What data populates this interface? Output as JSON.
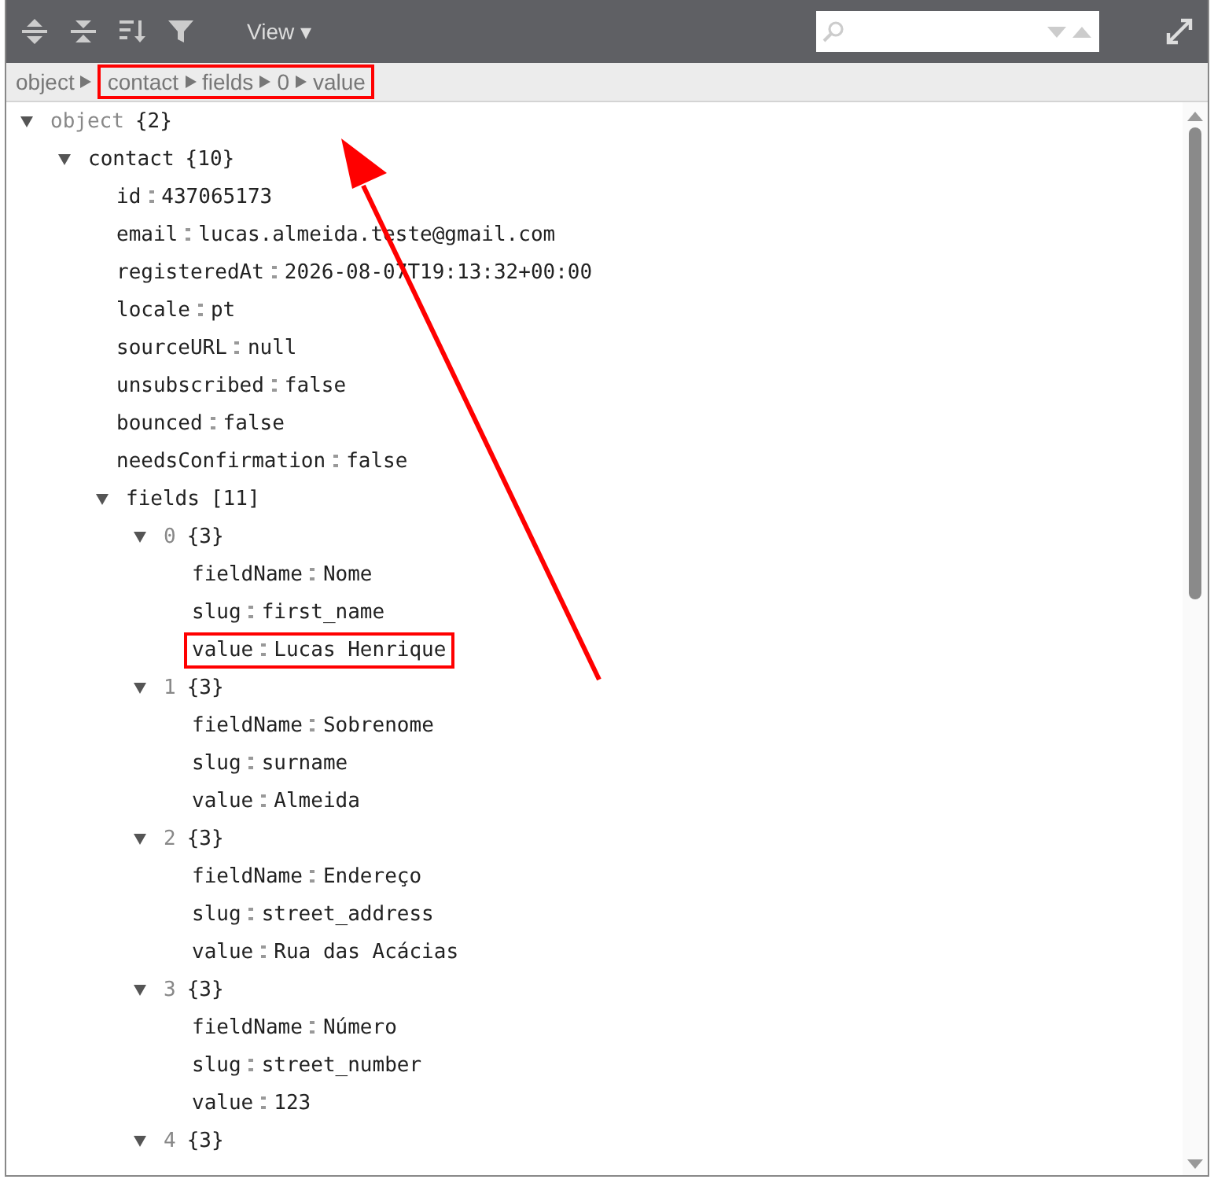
{
  "toolbar": {
    "view_menu": "View ▾"
  },
  "breadcrumb": [
    {
      "label": "object",
      "highlighted": false
    },
    {
      "label": "contact",
      "highlighted": true
    },
    {
      "label": "fields",
      "highlighted": true
    },
    {
      "label": "0",
      "highlighted": true
    },
    {
      "label": "value",
      "highlighted": true
    }
  ],
  "tree": [
    {
      "key": "object",
      "kind": "root",
      "summary": "{2}",
      "expanded": true,
      "children": [
        {
          "key": "contact",
          "kind": "property",
          "summary": "{10}",
          "expanded": true,
          "children": [
            {
              "key": "id ",
              "value": "437065173"
            },
            {
              "key": "email",
              "value": "lucas.almeida.teste@gmail.com"
            },
            {
              "key": "registeredAt",
              "value": "2026-08-07T19:13:32+00:00"
            },
            {
              "key": "locale",
              "value": "pt"
            },
            {
              "key": "sourceURL",
              "value": "null"
            },
            {
              "key": "unsubscribed",
              "value": "false"
            },
            {
              "key": "bounced",
              "value": "false"
            },
            {
              "key": "needsConfirmation",
              "value": "false"
            },
            {
              "key": "fields",
              "kind": "property",
              "summary": "[11]",
              "expanded": true,
              "children": [
                {
                  "key": "0",
                  "kind": "index",
                  "summary": "{3}",
                  "expanded": true,
                  "children": [
                    {
                      "key": "fieldName",
                      "value": "Nome"
                    },
                    {
                      "key": "slug",
                      "value": "first_name"
                    },
                    {
                      "key": "value",
                      "value": "Lucas Henrique",
                      "highlighted": true
                    }
                  ]
                },
                {
                  "key": "1",
                  "kind": "index",
                  "summary": "{3}",
                  "expanded": true,
                  "children": [
                    {
                      "key": "fieldName",
                      "value": "Sobrenome"
                    },
                    {
                      "key": "slug",
                      "value": "surname"
                    },
                    {
                      "key": "value",
                      "value": "Almeida"
                    }
                  ]
                },
                {
                  "key": "2",
                  "kind": "index",
                  "summary": "{3}",
                  "expanded": true,
                  "children": [
                    {
                      "key": "fieldName",
                      "value": "Endereço"
                    },
                    {
                      "key": "slug",
                      "value": "street_address"
                    },
                    {
                      "key": "value",
                      "value": "Rua das Acácias"
                    }
                  ]
                },
                {
                  "key": "3",
                  "kind": "index",
                  "summary": "{3}",
                  "expanded": true,
                  "children": [
                    {
                      "key": "fieldName",
                      "value": "Número"
                    },
                    {
                      "key": "slug",
                      "value": "street_number"
                    },
                    {
                      "key": "value",
                      "value": "123"
                    }
                  ]
                },
                {
                  "key": "4",
                  "kind": "index",
                  "summary": "{3}",
                  "expanded": true
                }
              ]
            }
          ]
        }
      ]
    }
  ]
}
